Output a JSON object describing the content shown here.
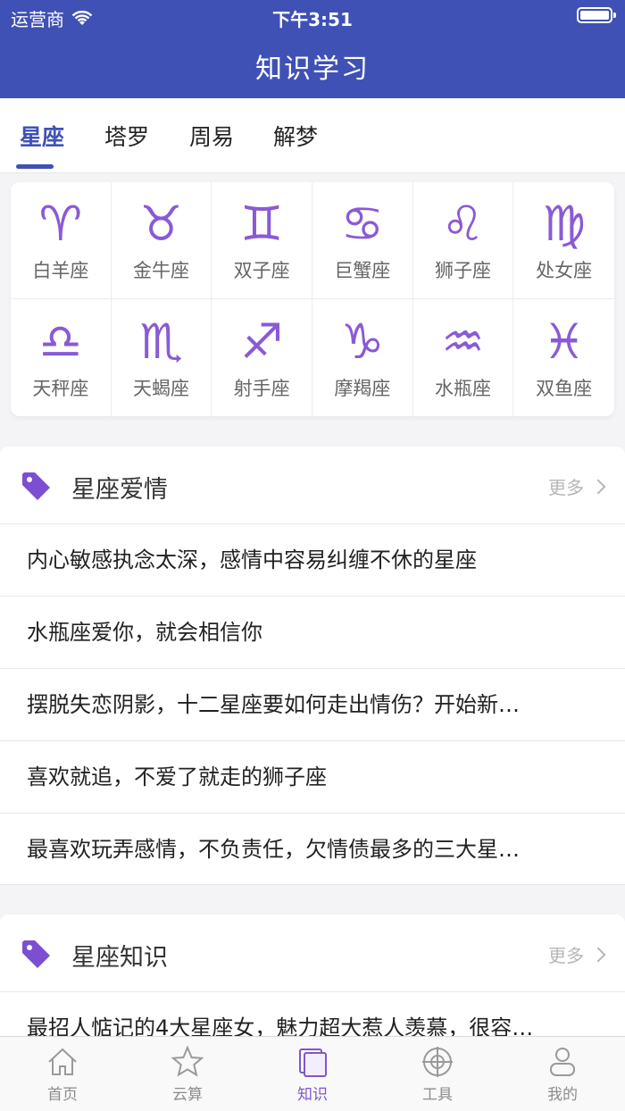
{
  "status": {
    "carrier": "运营商",
    "time": "下午3:51"
  },
  "header": {
    "title": "知识学习"
  },
  "tabs": [
    {
      "label": "星座"
    },
    {
      "label": "塔罗"
    },
    {
      "label": "周易"
    },
    {
      "label": "解梦"
    }
  ],
  "zodiac": [
    {
      "symbol": "♈",
      "name": "白羊座",
      "icon": "aries-icon"
    },
    {
      "symbol": "♉",
      "name": "金牛座",
      "icon": "taurus-icon"
    },
    {
      "symbol": "♊",
      "name": "双子座",
      "icon": "gemini-icon"
    },
    {
      "symbol": "♋",
      "name": "巨蟹座",
      "icon": "cancer-icon"
    },
    {
      "symbol": "♌",
      "name": "狮子座",
      "icon": "leo-icon"
    },
    {
      "symbol": "♍",
      "name": "处女座",
      "icon": "virgo-icon"
    },
    {
      "symbol": "♎",
      "name": "天秤座",
      "icon": "libra-icon"
    },
    {
      "symbol": "♏",
      "name": "天蝎座",
      "icon": "scorpio-icon"
    },
    {
      "symbol": "♐",
      "name": "射手座",
      "icon": "sagittarius-icon"
    },
    {
      "symbol": "♑",
      "name": "摩羯座",
      "icon": "capricorn-icon"
    },
    {
      "symbol": "♒",
      "name": "水瓶座",
      "icon": "aquarius-icon"
    },
    {
      "symbol": "♓",
      "name": "双鱼座",
      "icon": "pisces-icon"
    }
  ],
  "love_section": {
    "title": "星座爱情",
    "more": "更多",
    "articles": [
      "内心敏感执念太深，感情中容易纠缠不休的星座",
      "水瓶座爱你，就会相信你",
      "摆脱失恋阴影，十二星座要如何走出情伤？开始新…",
      "喜欢就追，不爱了就走的狮子座",
      "最喜欢玩弄感情，不负责任，欠情债最多的三大星…"
    ]
  },
  "knowledge_section": {
    "title": "星座知识",
    "more": "更多",
    "articles": [
      "最招人惦记的4大星座女，魅力超大惹人羡慕，很容…"
    ]
  },
  "bottom_nav": [
    {
      "label": "首页",
      "icon": "home-icon"
    },
    {
      "label": "云算",
      "icon": "star-icon"
    },
    {
      "label": "知识",
      "icon": "book-icon"
    },
    {
      "label": "工具",
      "icon": "crosshair-icon"
    },
    {
      "label": "我的",
      "icon": "person-icon"
    }
  ],
  "colors": {
    "primary": "#3f51b5",
    "accent": "#8a5ad6",
    "nav_active": "#7f57c9"
  }
}
